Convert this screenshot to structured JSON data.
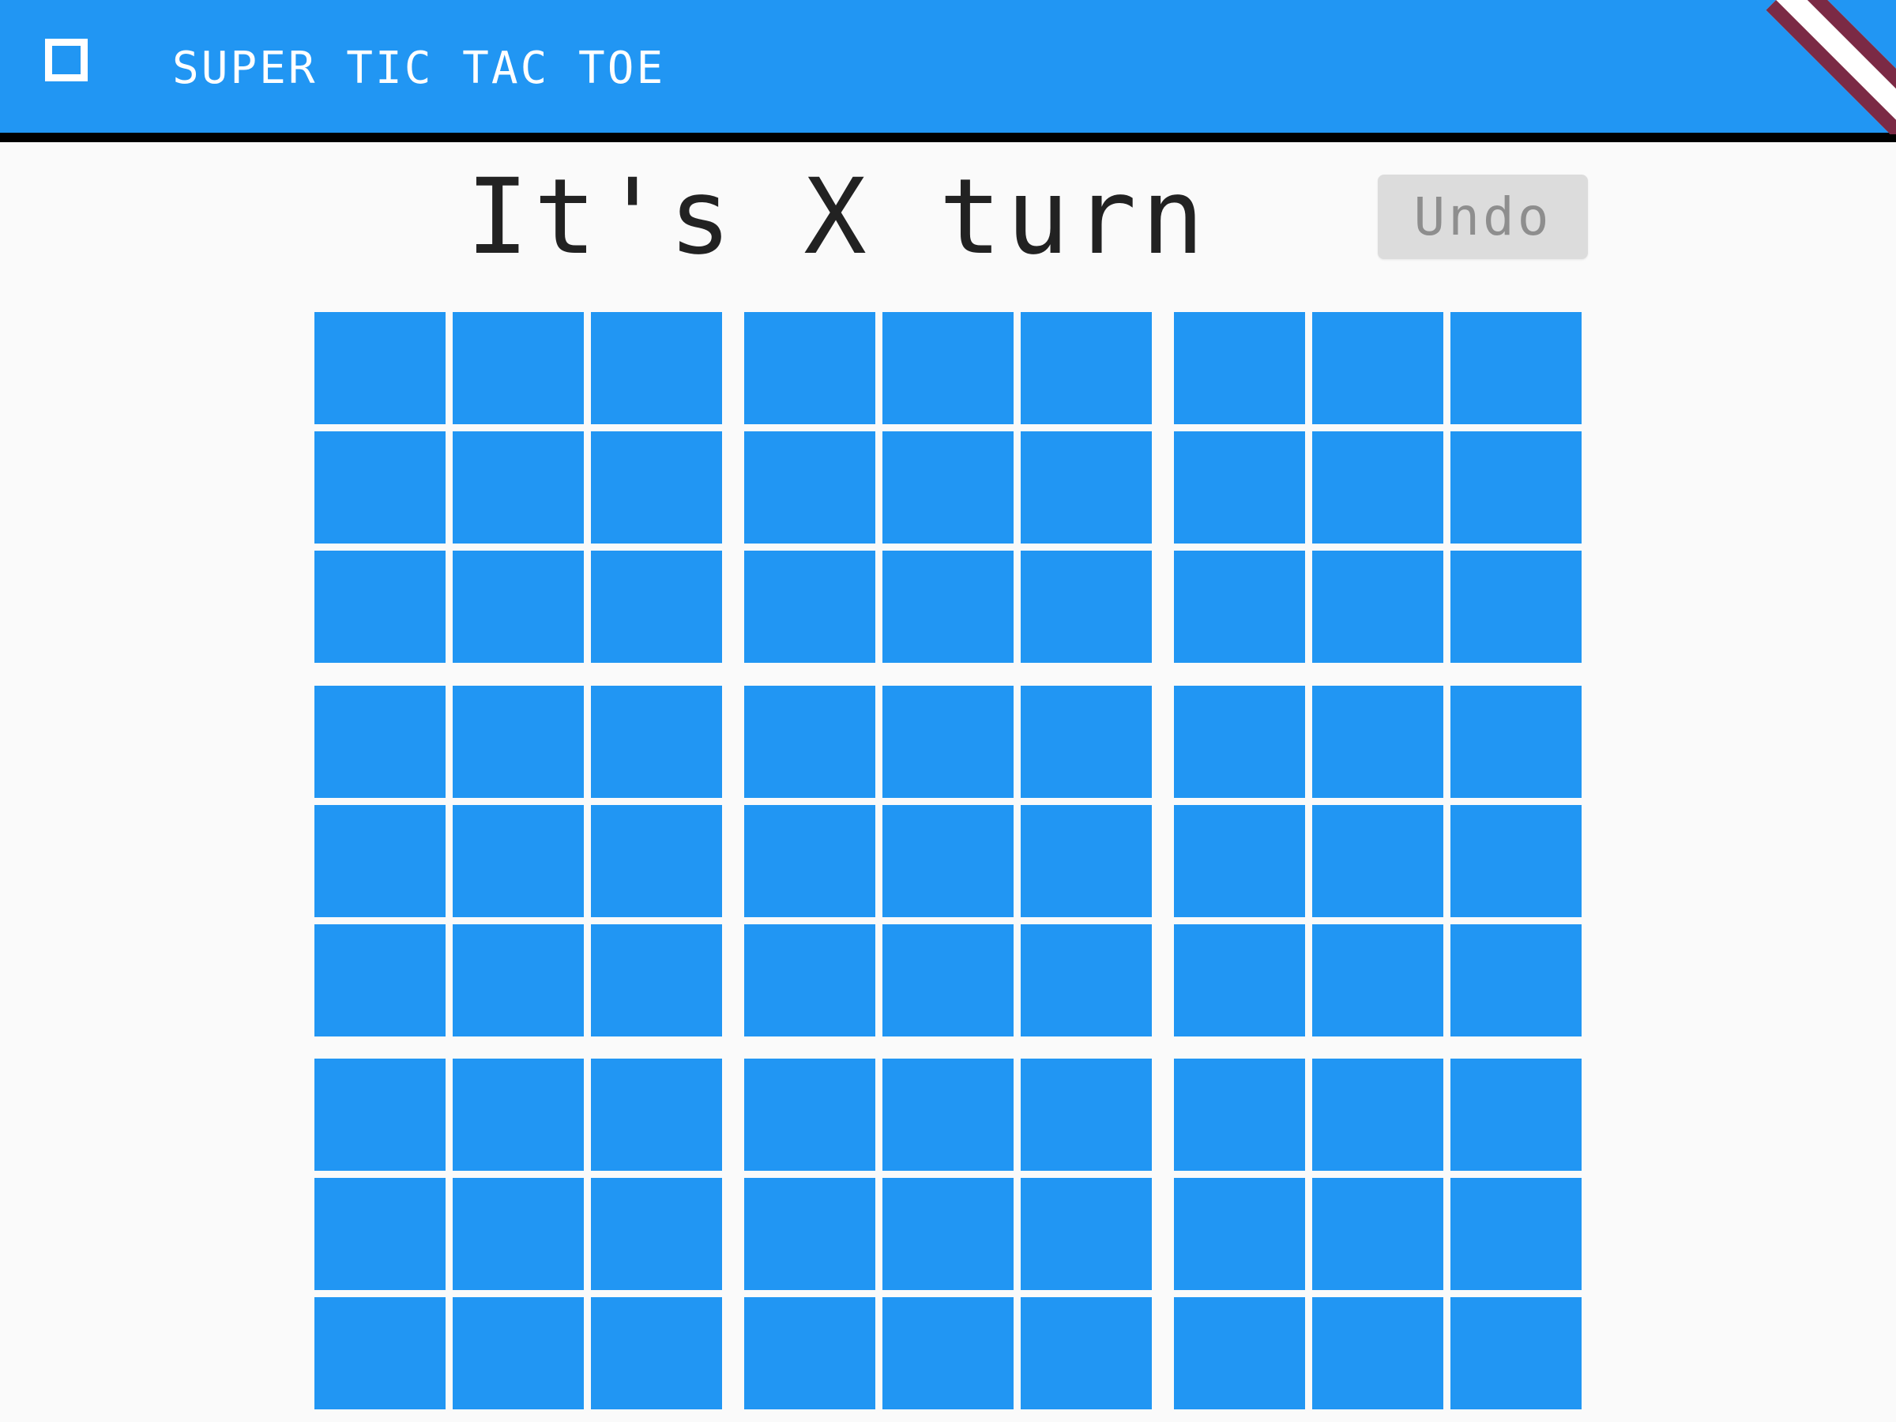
{
  "app_bar": {
    "title": "SUPER TIC TAC TOE",
    "menu_icon": "square-outline-icon",
    "background_color": "#2196f3",
    "text_color": "#ffffff"
  },
  "status": {
    "turn_text": "It's X turn"
  },
  "undo": {
    "label": "Undo",
    "enabled": false
  },
  "board": {
    "macro_rows": 3,
    "macro_cols": 3,
    "cells_per_side": 3,
    "cell_color": "#2196f3",
    "cells": [
      [
        "",
        "",
        "",
        "",
        "",
        "",
        "",
        "",
        ""
      ],
      [
        "",
        "",
        "",
        "",
        "",
        "",
        "",
        "",
        ""
      ],
      [
        "",
        "",
        "",
        "",
        "",
        "",
        "",
        "",
        ""
      ],
      [
        "",
        "",
        "",
        "",
        "",
        "",
        "",
        "",
        ""
      ],
      [
        "",
        "",
        "",
        "",
        "",
        "",
        "",
        "",
        ""
      ],
      [
        "",
        "",
        "",
        "",
        "",
        "",
        "",
        "",
        ""
      ],
      [
        "",
        "",
        "",
        "",
        "",
        "",
        "",
        "",
        ""
      ],
      [
        "",
        "",
        "",
        "",
        "",
        "",
        "",
        "",
        ""
      ],
      [
        "",
        "",
        "",
        "",
        "",
        "",
        "",
        "",
        ""
      ]
    ]
  },
  "debug_banner_color": "#7b2a45"
}
